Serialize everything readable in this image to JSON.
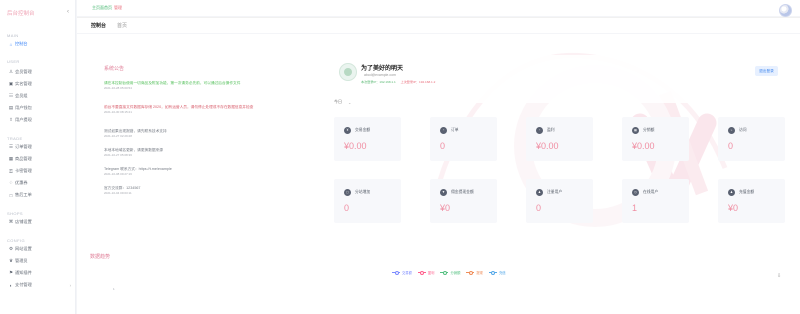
{
  "app": {
    "brand": "后台控制台"
  },
  "sidebar": {
    "groups": [
      "MAIN",
      "USER",
      "TRADE",
      "SHOPS",
      "CONFIG"
    ],
    "items": [
      {
        "label": "控制台",
        "icon": "home-icon"
      },
      {
        "label": "会员管理",
        "icon": "user-icon"
      },
      {
        "label": "实名管理",
        "icon": "idcard-icon"
      },
      {
        "label": "会员组",
        "icon": "group-icon"
      },
      {
        "label": "用户钱包",
        "icon": "wallet-icon"
      },
      {
        "label": "用户提现",
        "icon": "withdraw-icon"
      },
      {
        "label": "订单管理",
        "icon": "order-icon"
      },
      {
        "label": "商品管理",
        "icon": "goods-icon"
      },
      {
        "label": "卡密管理",
        "icon": "key-icon"
      },
      {
        "label": "优惠券",
        "icon": "coupon-icon"
      },
      {
        "label": "售后工单",
        "icon": "ticket-icon"
      },
      {
        "label": "店铺设置",
        "icon": "shop-icon"
      },
      {
        "label": "网站设置",
        "icon": "settings-icon"
      },
      {
        "label": "管理员",
        "icon": "admin-icon"
      },
      {
        "label": "通知插件",
        "icon": "plugin-icon"
      },
      {
        "label": "支付管理",
        "icon": "payment-icon"
      }
    ]
  },
  "topbar": {
    "site_label": "主页面首页",
    "admin_label": "管理"
  },
  "tabs": [
    {
      "label": "控制台"
    },
    {
      "label": "首页"
    }
  ],
  "notice": {
    "title": "系统公告",
    "items": [
      {
        "text": "请在本控制台使用一切商品及附加功能，第一次请务必先前，可以通过后台操作文件",
        "date": "2021-10-28 05:00:54",
        "tone": "green"
      },
      {
        "text": "前台不要直接文件数据库存储 2020，如有运营人员，请勿停止处理或不存在数据信息并检查",
        "date": "2021-10-30 08:15:21",
        "tone": "red"
      },
      {
        "text": "测试如果出现报错，请先联系技术支持",
        "date": "2021-10-27 02:29:28",
        "tone": "plain"
      },
      {
        "text": "本地本地域名更新，请更换数据来源",
        "date": "2021-10-27 05:08:36",
        "tone": "plain"
      },
      {
        "text": "Telegram 联系方式：https://t.me/example",
        "date": "2021-10-08 09:27:16",
        "tone": "plain"
      },
      {
        "text": "官方交流群：1234567",
        "date": "2021-10-04 09:03:11",
        "tone": "plain"
      }
    ]
  },
  "profile": {
    "name": "为了美好的明天",
    "email": "abcd@example.com",
    "meta_green": "本次登录IP：192.168.1.1",
    "meta_red": "上次登录IP：192.168.1.2",
    "logout": "退出登录"
  },
  "filter": {
    "range": "今日"
  },
  "stats": [
    {
      "label": "交易金额",
      "value": "¥0.00",
      "icon": "money-icon"
    },
    {
      "label": "订单",
      "value": "0",
      "icon": "order-icon"
    },
    {
      "label": "盈利",
      "value": "¥0.00",
      "icon": "profit-icon"
    },
    {
      "label": "分销额",
      "value": "¥0.00",
      "icon": "distribution-icon"
    },
    {
      "label": "访问",
      "value": "0",
      "icon": "visit-icon"
    },
    {
      "label": "分站增加",
      "value": "0",
      "icon": "branch-icon"
    },
    {
      "label": "佣金提现金额",
      "value": "¥0",
      "icon": "commission-icon"
    },
    {
      "label": "注册用户",
      "value": "0",
      "icon": "register-icon"
    },
    {
      "label": "在线用户",
      "value": "1",
      "icon": "online-icon"
    },
    {
      "label": "充值金额",
      "value": "¥0",
      "icon": "recharge-icon"
    }
  ],
  "trend": {
    "title": "数据趋势",
    "legend": [
      "交易额",
      "盈利",
      "分销额",
      "提现",
      "充值"
    ],
    "y_tick": "1"
  }
}
